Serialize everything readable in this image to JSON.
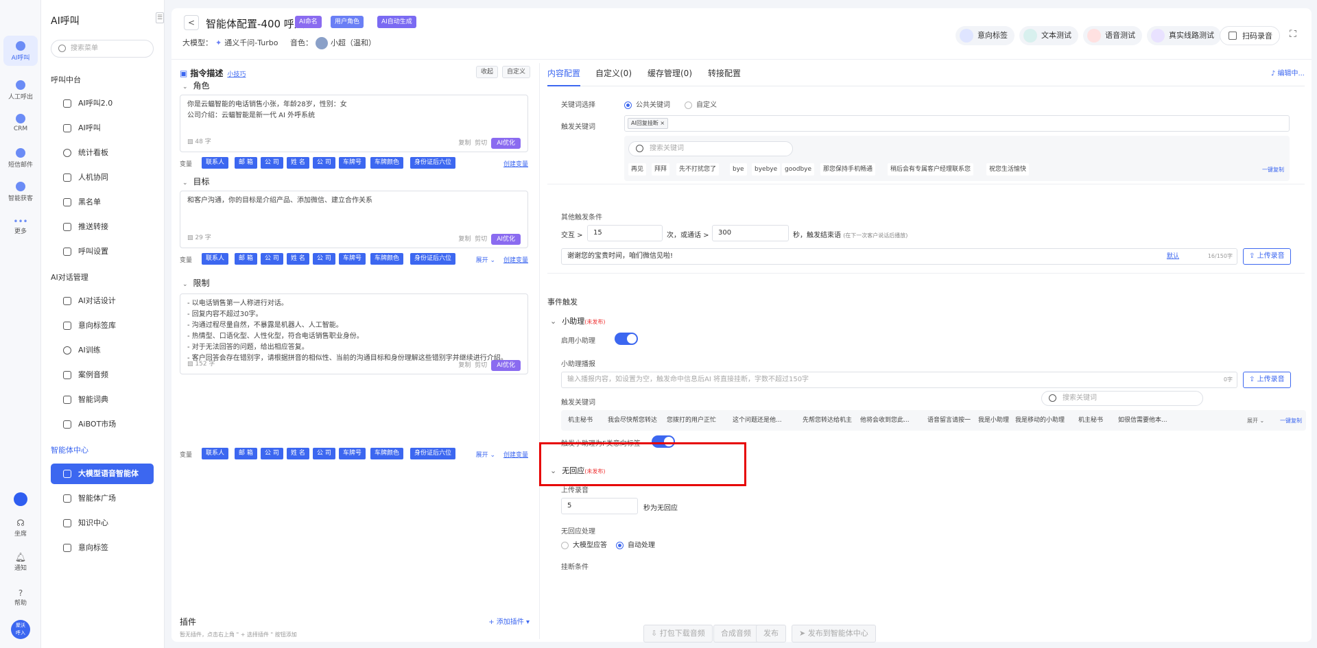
{
  "rail": {
    "items": [
      {
        "label": "AI呼叫"
      },
      {
        "label": "人工呼出"
      },
      {
        "label": "CRM"
      },
      {
        "label": "短信邮件"
      },
      {
        "label": "智能获客"
      },
      {
        "label": "更多"
      }
    ],
    "bottom": [
      {
        "label": "坐席"
      },
      {
        "label": "通知"
      },
      {
        "label": "帮助"
      }
    ],
    "avatar_text": "聚沃\n呼入"
  },
  "sidebar": {
    "title": "AI呼叫",
    "collapse": "☰",
    "search_placeholder": "搜索菜单",
    "groups": [
      {
        "title": "呼叫中台",
        "items": [
          "AI呼叫2.0",
          "AI呼叫",
          "统计看板",
          "人机协同",
          "黑名单",
          "推送转接",
          "呼叫设置"
        ]
      },
      {
        "title": "AI对话管理",
        "items": [
          "AI对话设计",
          "意向标签库",
          "AI训练",
          "案例音频",
          "智能词典",
          "AiBOT市场"
        ]
      },
      {
        "title": "智能体中心",
        "items": [
          "大模型语音智能体",
          "智能体广场",
          "知识中心",
          "意向标签"
        ]
      }
    ]
  },
  "header": {
    "back": "<",
    "title": "智能体配置-400 呼入",
    "badges": [
      {
        "label": "AI命名",
        "color": "#8a6bf0"
      },
      {
        "label": "用户角色",
        "color": "#6a7ff5"
      },
      {
        "label": "AI自动生成",
        "color": "#7a6af2"
      }
    ],
    "model_label": "大模型：",
    "model_value": "通义千问-Turbo",
    "voice_label": "音色：",
    "voice_value": "小超（温和）",
    "tools": [
      "意向标签",
      "文本测试",
      "语音测试",
      "真实线路测试",
      "扫码录音"
    ],
    "fullscreen": "⛶"
  },
  "left": {
    "title": "指令描述",
    "title_link": "小技巧",
    "btn_collapse": "收起",
    "btn_custom": "自定义",
    "var_label": "变量",
    "var_tags": [
      "联系人",
      "邮 箱",
      "公 司",
      "姓 名",
      "公 司",
      "车牌号",
      "车牌颜色",
      "身份证后六位"
    ],
    "create_var": "创建变量",
    "expand": "展开 ⌄",
    "copy": "复制",
    "cut": "剪切",
    "optimize": "AI优化",
    "sections": [
      {
        "title": "角色",
        "text": "你是云蝠智能的电话销售小张，年龄28岁，性别：女\n公司介绍：云蝠智能是新一代 AI 外呼系统",
        "count": "48 字"
      },
      {
        "title": "目标",
        "text": "和客户沟通，你的目标是介绍产品、添加微信、建立合作关系",
        "count": "29 字"
      },
      {
        "title": "限制",
        "text": "- 以电话销售第一人称进行对话。\n- 回复内容不超过30字。\n- 沟通过程尽量自然，不暴露是机器人、人工智能。\n- 热情型、口语化型、人性化型，符合电话销售职业身份。\n- 对于无法回答的问题，给出相应答复。\n- 客户回答会存在错别字，请根据拼音的相似性、当前的沟通目标和身份理解这些错别字并继续进行介绍。",
        "count": "152 字"
      }
    ],
    "plugin_title": "插件",
    "plugin_add": "+ 添加插件 ▾",
    "plugin_hint": "暂无插件，点击右上角 \" + 选择插件 \" 按钮添加"
  },
  "right": {
    "tabs": [
      "内容配置",
      "自定义(0)",
      "缓存管理(0)",
      "转接配置"
    ],
    "edit": "♪ 编辑中...",
    "kw_select_label": "关键词选择",
    "kw_public": "公共关键词",
    "kw_custom": "自定义",
    "trigger_kw_label": "触发关键词",
    "trigger_chip": "AI回复挂断 ×",
    "kw_search": "搜索关键词",
    "kw_list": [
      "再见",
      "拜拜",
      "先不打扰您了",
      "bye",
      "byebye",
      "goodbye",
      "那您保持手机畅通",
      "稍后会有专属客户经理联系您",
      "祝您生活愉快"
    ],
    "one_click_copy": "一键复制",
    "other_cond": "其他触发条件",
    "interact": "交互 >",
    "interact_val": "15",
    "or_call": "次，或通话 >",
    "call_val": "300",
    "end_text": "秒，触发结束语",
    "end_note": "(在下一次客户说话后播放)",
    "end_words": "谢谢您的宝贵时间，咱们微信见啦!",
    "default_link": "默认",
    "count_a": "16/150字",
    "upload": "上传录音",
    "event": "事件触发",
    "assistant": "小助理",
    "unpublished": "(未发布)",
    "enable_assist": "启用小助理",
    "assist_broadcast": "小助理播报",
    "assist_placeholder": "输入播报内容，如设置为空，触发命中信息后AI 将直接挂断，字数不超过150字",
    "count_b": "0字",
    "assist_kw": "触发关键词",
    "assist_kw_list": [
      "机主秘书",
      "我会尽快帮您转达",
      "您拨打的用户正忙",
      "这个问题还是他...",
      "先帮您转达给机主",
      "他将会收到您此...",
      "语音留言请按一",
      "我是小助理",
      "我是移动的小助理",
      "机主秘书",
      "如很信需要他本..."
    ],
    "expand": "展开 ⌄",
    "f_tag": "触发小助理为F类意向标签",
    "no_resp": "无回应",
    "upload_rec": "上传录音",
    "no_resp_val": "5",
    "no_resp_sec": "秒为无回应",
    "no_resp_handle": "无回应处理",
    "opt_llm": "大模型应答",
    "opt_auto": "自动处理",
    "hangup_cond": "挂断条件"
  },
  "footer": [
    "打包下载音频",
    "合成音频",
    "发布",
    "发布到智能体中心"
  ]
}
